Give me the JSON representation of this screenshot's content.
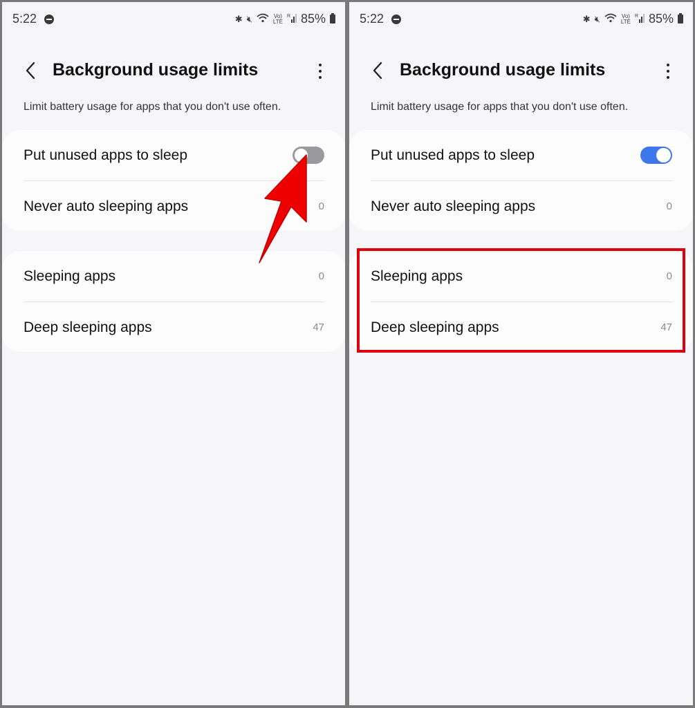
{
  "panels": [
    {
      "status_bar": {
        "time": "5:22",
        "battery": "85%",
        "icons": [
          "do-not-disturb",
          "bluetooth",
          "mute",
          "wifi",
          "volte-lte",
          "signal-roaming",
          "battery"
        ],
        "volte_top": "Vo)",
        "volte_bottom": "LTE",
        "roaming": "R"
      },
      "header": {
        "title": "Background usage limits"
      },
      "description": "Limit battery usage for apps that you don't use often.",
      "settings": [
        {
          "label": "Put unused apps to sleep",
          "toggle": false
        },
        {
          "label": "Never auto sleeping apps",
          "count": "0"
        }
      ],
      "app_lists": [
        {
          "label": "Sleeping apps",
          "count": "0"
        },
        {
          "label": "Deep sleeping apps",
          "count": "47"
        }
      ],
      "annotation": "red-arrow-pointing-at-toggle"
    },
    {
      "status_bar": {
        "time": "5:22",
        "battery": "85%",
        "icons": [
          "do-not-disturb",
          "bluetooth",
          "mute",
          "wifi",
          "volte-lte",
          "signal-roaming",
          "battery"
        ],
        "volte_top": "Vo)",
        "volte_bottom": "LTE",
        "roaming": "R"
      },
      "header": {
        "title": "Background usage limits"
      },
      "description": "Limit battery usage for apps that you don't use often.",
      "settings": [
        {
          "label": "Put unused apps to sleep",
          "toggle": true
        },
        {
          "label": "Never auto sleeping apps",
          "count": "0"
        }
      ],
      "app_lists": [
        {
          "label": "Sleeping apps",
          "count": "0"
        },
        {
          "label": "Deep sleeping apps",
          "count": "47"
        }
      ],
      "annotation": "red-box-highlighting-sleeping-lists"
    }
  ],
  "colors": {
    "toggle_on": "#3e76ec",
    "toggle_off": "#9a9a9e",
    "annotation_red": "#e0000f",
    "background": "#f6f6f8"
  }
}
